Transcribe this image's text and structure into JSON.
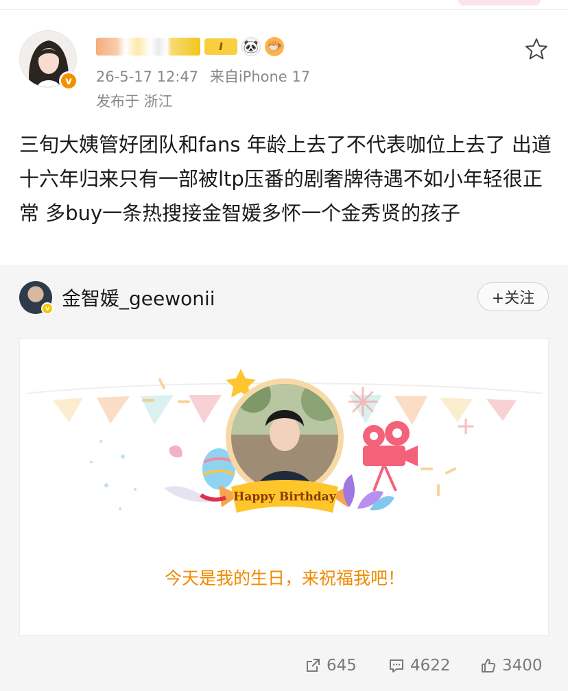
{
  "post": {
    "level_badge": "I",
    "timestamp": "26-5-17 12:47",
    "source": "来自iPhone 17",
    "location": "发布于 浙江",
    "text": "三旬大姨管好团队和fans 年龄上去了不代表咖位上去了 出道十六年归来只有一部被ltp压番的剧奢牌待遇不如小年轻很正常 多buy一条热搜接金智媛多怀一个金秀贤的孩子"
  },
  "repost": {
    "author": "金智媛_geewonii",
    "follow_label": "+关注",
    "card_banner": "Happy Birthday",
    "card_caption": "今天是我的生日，来祝福我吧！"
  },
  "actions": {
    "share_count": "645",
    "comment_count": "4622",
    "like_count": "3400"
  },
  "colors": {
    "verified_orange": "#f29100",
    "caption_orange": "#f08a00",
    "meta_gray": "#888888"
  },
  "icons": [
    "star-icon",
    "verified-icon",
    "panda-icon",
    "fish-icon",
    "share-icon",
    "comment-icon",
    "like-icon",
    "camera-icon"
  ]
}
